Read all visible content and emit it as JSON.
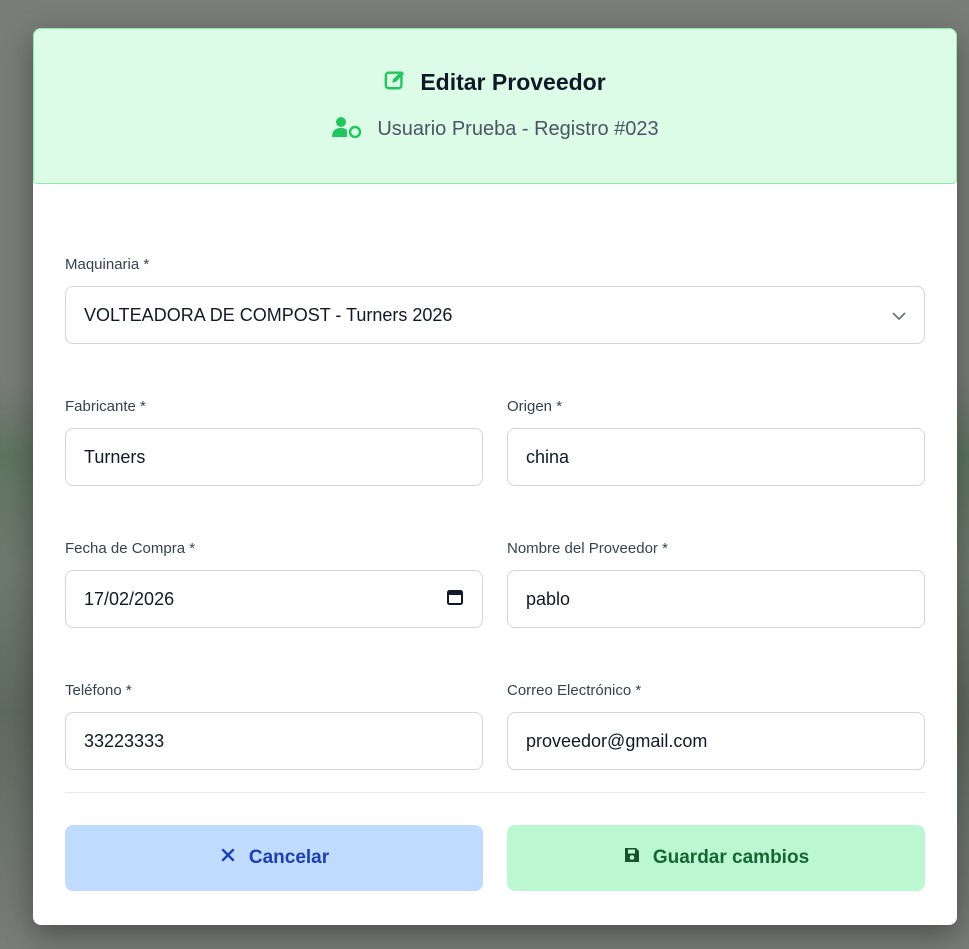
{
  "header": {
    "title": "Editar Proveedor",
    "subtitle": "Usuario Prueba - Registro #023",
    "accent_color": "#22c55e",
    "icons": {
      "title": "edit-icon",
      "subtitle": "user-shield-icon"
    }
  },
  "form": {
    "maquinaria": {
      "label": "Maquinaria *",
      "value": "VOLTEADORA DE COMPOST - Turners 2026"
    },
    "fabricante": {
      "label": "Fabricante *",
      "value": "Turners"
    },
    "origen": {
      "label": "Origen *",
      "value": "china"
    },
    "fecha_compra": {
      "label": "Fecha de Compra *",
      "value": "17/02/2026"
    },
    "nombre_proveedor": {
      "label": "Nombre del Proveedor *",
      "value": "pablo"
    },
    "telefono": {
      "label": "Teléfono *",
      "value": "33223333"
    },
    "correo": {
      "label": "Correo Electrónico *",
      "value": "proveedor@gmail.com"
    }
  },
  "actions": {
    "cancel_label": "Cancelar",
    "save_label": "Guardar cambios",
    "cancel_color": "#bfdbfe",
    "save_color": "#bbf7d0"
  }
}
